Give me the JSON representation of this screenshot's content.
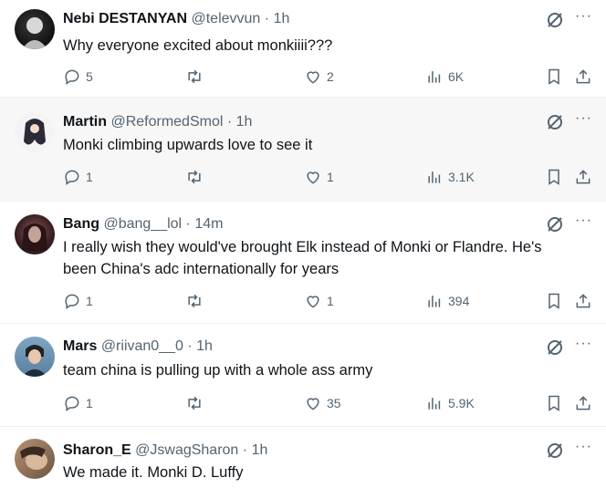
{
  "tweets": [
    {
      "name": "Nebi DESTANYAN",
      "handle": "@televvun",
      "time": "1h",
      "text": "Why everyone excited about monkiiii???",
      "replies": "5",
      "retweets": "",
      "likes": "2",
      "views": "6K"
    },
    {
      "name": "Martin",
      "handle": "@ReformedSmol",
      "time": "1h",
      "text": "Monki climbing upwards love to see it",
      "replies": "1",
      "retweets": "",
      "likes": "1",
      "views": "3.1K"
    },
    {
      "name": "Bang",
      "handle": "@bang__lol",
      "time": "14m",
      "text": "I really wish they would've brought Elk instead of Monki or Flandre. He's been China's adc internationally for years",
      "replies": "1",
      "retweets": "",
      "likes": "1",
      "views": "394"
    },
    {
      "name": "Mars",
      "handle": "@riivan0__0",
      "time": "1h",
      "text": "team china is pulling up with a whole ass army",
      "replies": "1",
      "retweets": "",
      "likes": "35",
      "views": "5.9K"
    },
    {
      "name": "Sharon_E",
      "handle": "@JswagSharon",
      "time": "1h",
      "text": "We made it. Monki D. Luffy",
      "replies": "",
      "retweets": "",
      "likes": "",
      "views": ""
    }
  ],
  "separator": "·",
  "more_label": "···",
  "colors": {
    "secondary_text": "#536471",
    "primary_text": "#0f1419",
    "divider": "#eff3f4"
  },
  "icons": [
    "reply-icon",
    "retweet-icon",
    "like-icon",
    "views-icon",
    "bookmark-icon",
    "share-icon",
    "grok-icon",
    "more-icon"
  ]
}
